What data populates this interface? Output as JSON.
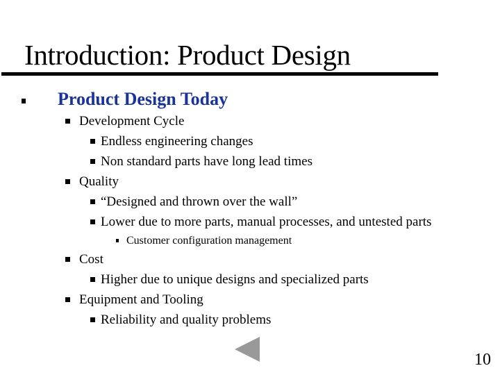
{
  "slide": {
    "title": "Introduction: Product Design",
    "heading": "Product Design Today",
    "items": [
      {
        "level": 2,
        "text": "Development Cycle"
      },
      {
        "level": 3,
        "text": "Endless engineering changes"
      },
      {
        "level": 3,
        "text": "Non standard parts have long lead times"
      },
      {
        "level": 2,
        "text": "Quality"
      },
      {
        "level": 3,
        "text": "“Designed and thrown over the wall”"
      },
      {
        "level": 3,
        "text": "Lower due to more parts, manual processes,  and untested parts"
      },
      {
        "level": 4,
        "text": "Customer configuration management"
      },
      {
        "level": 2,
        "text": "Cost"
      },
      {
        "level": 3,
        "text": "Higher due to unique designs and specialized parts"
      },
      {
        "level": 2,
        "text": "Equipment and Tooling"
      },
      {
        "level": 3,
        "text": "Reliability and quality problems"
      }
    ],
    "page_number": "10",
    "nav": {
      "previous_icon": "triangle-left-icon"
    }
  },
  "colors": {
    "heading": "#1a3399",
    "nav_arrow": "#999999"
  }
}
